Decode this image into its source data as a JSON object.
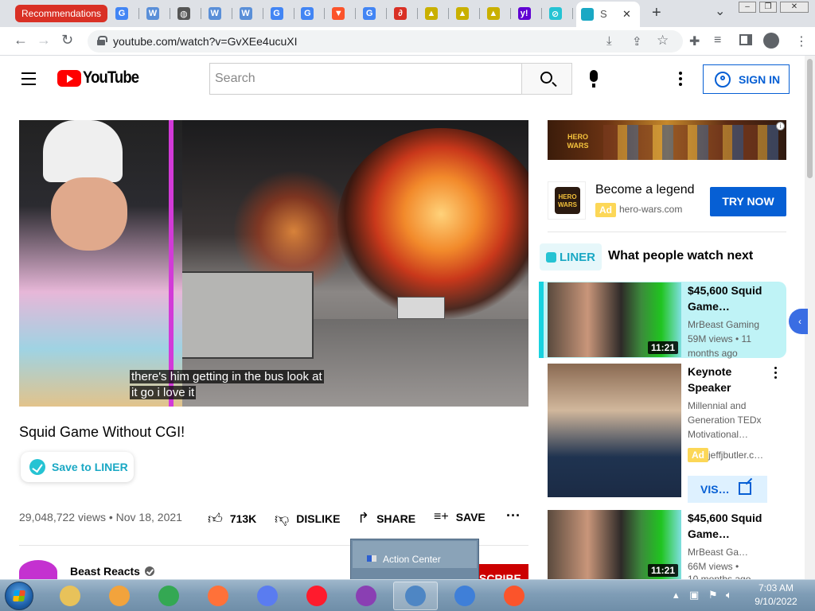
{
  "browser": {
    "tabs": {
      "first_label": "Recommendations",
      "mini": [
        {
          "letter": "G",
          "color": "#4285f4"
        },
        {
          "letter": "W",
          "color": "#5a8fd8"
        },
        {
          "letter": "◍",
          "color": "#555555"
        },
        {
          "letter": "W",
          "color": "#5a8fd8"
        },
        {
          "letter": "W",
          "color": "#5a8fd8"
        },
        {
          "letter": "G",
          "color": "#4285f4"
        },
        {
          "letter": "G",
          "color": "#4285f4"
        },
        {
          "letter": "▼",
          "color": "#fb542b"
        },
        {
          "letter": "G",
          "color": "#4285f4"
        },
        {
          "letter": "∂",
          "color": "#d93025"
        },
        {
          "letter": "▲",
          "color": "#c9b000"
        },
        {
          "letter": "▲",
          "color": "#c9b000"
        },
        {
          "letter": "▲",
          "color": "#c9b000"
        },
        {
          "letter": "y!",
          "color": "#6001d2"
        },
        {
          "letter": "⊘",
          "color": "#25c3d3"
        }
      ],
      "active_label": "S",
      "close_glyph": "✕",
      "new_tab_glyph": "+",
      "chevron_glyph": "⌄"
    },
    "url": "youtube.com/watch?v=GvXEe4ucuXI"
  },
  "youtube": {
    "logo_text": "YouTube",
    "search_placeholder": "Search",
    "sign_in": "SIGN IN"
  },
  "video": {
    "caption_line1": "there's him getting in the bus look at",
    "caption_line2": "it go i love it",
    "title": "Squid Game Without CGI!",
    "liner_save": "Save to LINER",
    "views_date": "29,048,722 views • Nov 18, 2021",
    "likes": "713K",
    "dislike": "DISLIKE",
    "share": "SHARE",
    "save": "SAVE",
    "channel": "Beast Reacts",
    "subscribe": "SCRIBE"
  },
  "sidebar": {
    "ad": {
      "title": "Become a legend",
      "badge": "Ad",
      "domain": "hero-wars.com",
      "cta": "TRY NOW",
      "banner_logo": "HERO WARS",
      "icon_logo": "HERO WARS"
    },
    "liner_brand": "LINER",
    "next_heading": "What people watch next",
    "recs": [
      {
        "title": "$45,600 Squid Game…",
        "channel": "MrBeast Gaming",
        "meta": "59M views • 11 months ago",
        "duration": "11:21"
      },
      {
        "title": "Keynote Speaker",
        "channel": "Millennial and Generation TEDx Motivational…",
        "badge": "Ad",
        "domain": "jeffjbutler.c…",
        "visit": "VIS…"
      },
      {
        "title": "$45,600 Squid Game…",
        "channel": "MrBeast Ga…",
        "meta": "66M views •",
        "meta2": "10 months ago",
        "duration": "11:21"
      }
    ]
  },
  "overlay": {
    "action_center": "Action Center"
  },
  "taskbar": {
    "time": "7:03 AM",
    "date": "9/10/2022",
    "apps": [
      {
        "name": "explorer",
        "color": "#e8c25a"
      },
      {
        "name": "media-player",
        "color": "#f2a33c"
      },
      {
        "name": "chrome",
        "color": "#34a853"
      },
      {
        "name": "firefox",
        "color": "#ff7139"
      },
      {
        "name": "chromium-avast",
        "color": "#5a7cf0"
      },
      {
        "name": "opera",
        "color": "#ff1b2d"
      },
      {
        "name": "winrar",
        "color": "#8a3fb3"
      },
      {
        "name": "control-panel",
        "color": "#4e86c4"
      },
      {
        "name": "qbittorrent",
        "color": "#3f7fd8"
      },
      {
        "name": "brave",
        "color": "#fb542b"
      }
    ]
  }
}
